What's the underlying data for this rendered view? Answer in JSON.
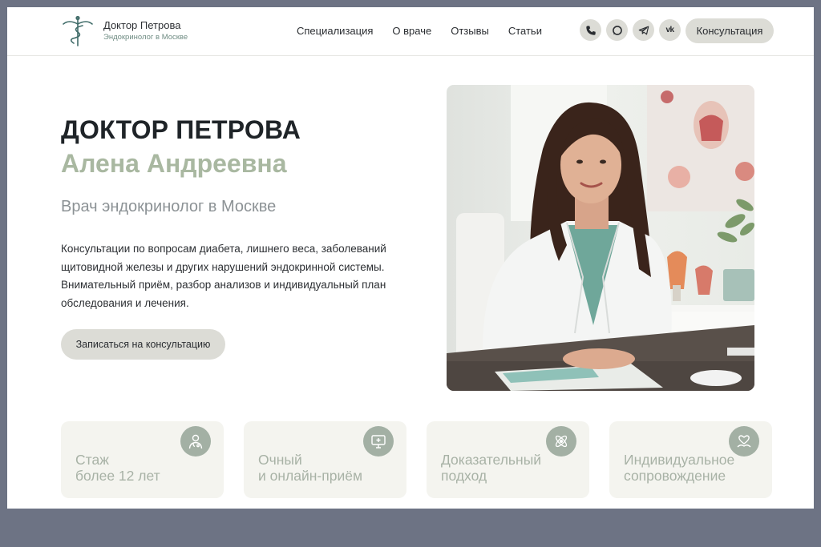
{
  "header": {
    "brand_name": "Доктор Петрова",
    "brand_sub": "Эндокринолог в Москве",
    "nav": [
      "Специализация",
      "О враче",
      "Отзывы",
      "Статьи"
    ],
    "socials": [
      "phone-icon",
      "whatsapp-icon",
      "telegram-icon",
      "vk-icon"
    ],
    "vk_label": "vk",
    "consult_label": "Консультация"
  },
  "hero": {
    "title": "ДОКТОР ПЕТРОВА",
    "name": "Алена Андреевна",
    "subtitle": "Врач эндокринолог в Москве",
    "description": "Консультации по вопросам диабета, лишнего веса, заболеваний щитовидной железы и других нарушений эндокринной системы. Внимательный приём, разбор анализов и индивидуальный план обследования и лечения.",
    "cta_label": "Записаться на консультацию"
  },
  "features": [
    {
      "line1": "Стаж",
      "line2": "более 12 лет",
      "icon": "doctor-icon"
    },
    {
      "line1": "Очный",
      "line2": "и онлайн-приём",
      "icon": "monitor-icon"
    },
    {
      "line1": "Доказательный",
      "line2": "подход",
      "icon": "atom-icon"
    },
    {
      "line1": "Индивидуальное",
      "line2": "сопровождение",
      "icon": "heart-hand-icon"
    }
  ],
  "colors": {
    "accent_green": "#a9b8a1",
    "button_bg": "#dcdcd6",
    "card_bg": "#f4f4ef",
    "frame": "#6d7384"
  }
}
